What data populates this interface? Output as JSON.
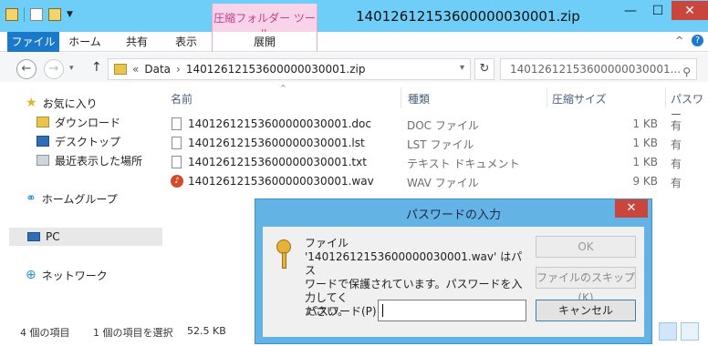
{
  "window": {
    "title": "14012612153600000030001.zip",
    "context_tab": "圧縮フォルダー ツール",
    "controls": {
      "minimize": "—",
      "maximize": "☐",
      "close": "✕"
    }
  },
  "ribbon": {
    "tabs": [
      "ファイル",
      "ホーム",
      "共有",
      "表示",
      "展開"
    ],
    "collapse_icon": "^",
    "help_icon": "?"
  },
  "address": {
    "back_icon": "←",
    "forward_icon": "→",
    "up_icon": "↑",
    "prefix": "«",
    "segments": [
      "Data",
      "14012612153600000030001.zip"
    ],
    "separator": "›",
    "dropdown": "▾",
    "refresh_icon": "↻"
  },
  "search": {
    "placeholder": "14012612153600000030001..."
  },
  "sidebar": {
    "favorites": "お気に入り",
    "downloads": "ダウンロード",
    "desktop": "デスクトップ",
    "recent": "最近表示した場所",
    "homegroup": "ホームグループ",
    "pc": "PC",
    "network": "ネットワーク"
  },
  "columns": {
    "name": "名前",
    "type": "種類",
    "compressed_size": "圧縮サイズ",
    "protected": "パスワー"
  },
  "files": [
    {
      "name": "14012612153600000030001.doc",
      "type": "DOC ファイル",
      "size": "1 KB",
      "protected": "有"
    },
    {
      "name": "14012612153600000030001.lst",
      "type": "LST ファイル",
      "size": "1 KB",
      "protected": "有"
    },
    {
      "name": "14012612153600000030001.txt",
      "type": "テキスト ドキュメント",
      "size": "1 KB",
      "protected": "有"
    },
    {
      "name": "14012612153600000030001.wav",
      "type": "WAV ファイル",
      "size": "9 KB",
      "protected": "有"
    }
  ],
  "status": {
    "count": "4 個の項目",
    "selected": "1 個の項目を選択",
    "size": "52.5 KB"
  },
  "dialog": {
    "title": "パスワードの入力",
    "close": "✕",
    "message_line1": "ファイル",
    "message_line2": "'14012612153600000030001.wav' はパス",
    "message_line3": "ワードで保護されています。パスワードを入力してく",
    "message_line4": "ださい。",
    "password_label": "パスワード(P):",
    "password_value": "",
    "ok": "OK",
    "skip": "ファイルのスキップ(K)",
    "cancel": "キャンセル"
  },
  "colors": {
    "titlebar": "#6fcef7",
    "file_tab": "#1979ca",
    "context_tab": "#f9d3ea",
    "close_button": "#c9463d",
    "dialog_frame": "#63b3e6"
  }
}
